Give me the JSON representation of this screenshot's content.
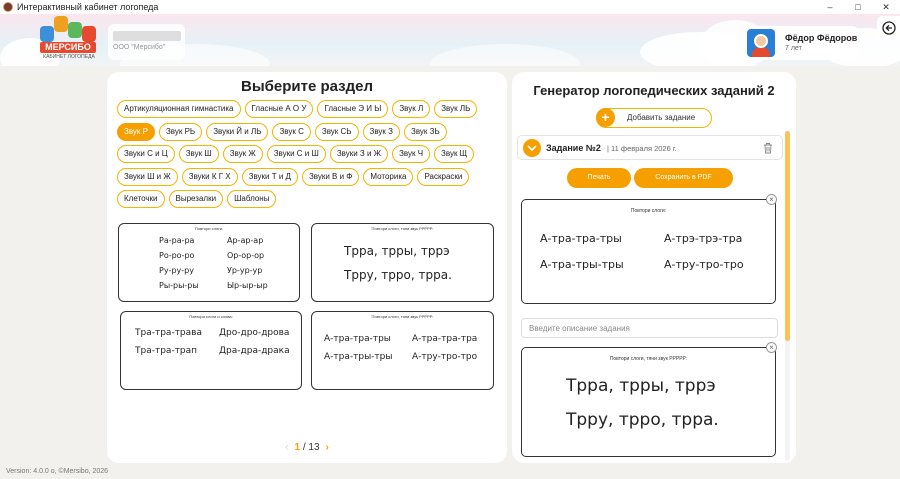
{
  "window": {
    "title": "Интерактивный кабинет логопеда",
    "controls": [
      "–",
      "□",
      "✕"
    ]
  },
  "header": {
    "logo_text": "МЕРСИБО",
    "logo_subtitle": "КАБИНЕТ ЛОГОПЕДА",
    "org_name": "ООО \"Мерсибо\"",
    "user_name": "Фёдор Фёдоров",
    "user_age": "7 лет",
    "back_icon": "arrow-left-circle-icon"
  },
  "sections": {
    "title": "Выберите раздел",
    "chips": [
      "Артикуляционная гимнастика",
      "Гласные А О У",
      "Гласные Э И Ы",
      "Звук Л",
      "Звук ЛЬ",
      "Звук Р",
      "Звук РЬ",
      "Звуки Й и ЛЬ",
      "Звук С",
      "Звук СЬ",
      "Звук З",
      "Звук ЗЬ",
      "Звуки С и Ц",
      "Звук Ш",
      "Звук Ж",
      "Звуки С и Ш",
      "Звуки З и Ж",
      "Звук Ч",
      "Звук Щ",
      "Звуки Ш и Ж",
      "Звуки К Г Х",
      "Звуки Т и Д",
      "Звуки В и Ф",
      "Моторика",
      "Раскраски",
      "Клеточки",
      "Вырезалки",
      "Шаблоны"
    ],
    "active_chip": "Звук Р"
  },
  "thumbnails": [
    {
      "caption": "Повтори слоги:",
      "left": [
        "Ра-ра-ра",
        "Ро-ро-ро",
        "Ру-ру-ру",
        "Ры-ры-ры"
      ],
      "right": [
        "Ар-ар-ар",
        "Ор-ор-ор",
        "Ур-ур-ур",
        "Ыр-ыр-ыр"
      ]
    },
    {
      "caption": "Повтори слоги, тяни звук РРРРР:",
      "lines": [
        "Трра, трры, тррэ",
        "Тррy, трро, трра."
      ]
    },
    {
      "caption": "Повтори слоги и слова:",
      "left": [
        "Тра-тра-трава",
        "Тра-тра-трап"
      ],
      "right": [
        "Дро-дро-дрова",
        "Дра-дра-драка"
      ]
    },
    {
      "caption": "Повтори слоги, тяни звук РРРРР:",
      "left": [
        "А-тра-тра-тры",
        "А-тра-тры-тры"
      ],
      "right": [
        "А-тра-тра-тра",
        "А-тру-тро-тро"
      ]
    }
  ],
  "pager": {
    "prev": "‹",
    "current": "1",
    "separator": " / ",
    "total": "13",
    "next": "›"
  },
  "generator": {
    "title": "Генератор логопедических заданий 2",
    "add_label": "Добавить задание",
    "add_icon": "+",
    "task_title": "Задание №2",
    "task_date": "| 11 февраля 2026 г.",
    "print_label": "Печать",
    "pdf_label": "Сохранить в PDF",
    "description_placeholder": "Введите описание задания",
    "close_icon": "×",
    "sheet1": {
      "caption": "Повтори слоги:",
      "left": [
        "А-тра-тра-тры",
        "А-тра-тры-тры"
      ],
      "right": [
        "А-трэ-трэ-тра",
        "А-тру-тро-тро"
      ]
    },
    "sheet2": {
      "caption": "Повтори слоги, тяни звук РРРРР:",
      "lines": [
        "Трра, трры, тррэ",
        "Тррy, трро, трра."
      ]
    }
  },
  "footer": {
    "version": "Version: 4.0.0 o, ©Mersibo, 2026"
  },
  "colors": {
    "accent": "#f5a000",
    "chip_border": "#f5b400",
    "logo_red": "#e64a2e",
    "avatar_blue": "#2a7fd4"
  }
}
